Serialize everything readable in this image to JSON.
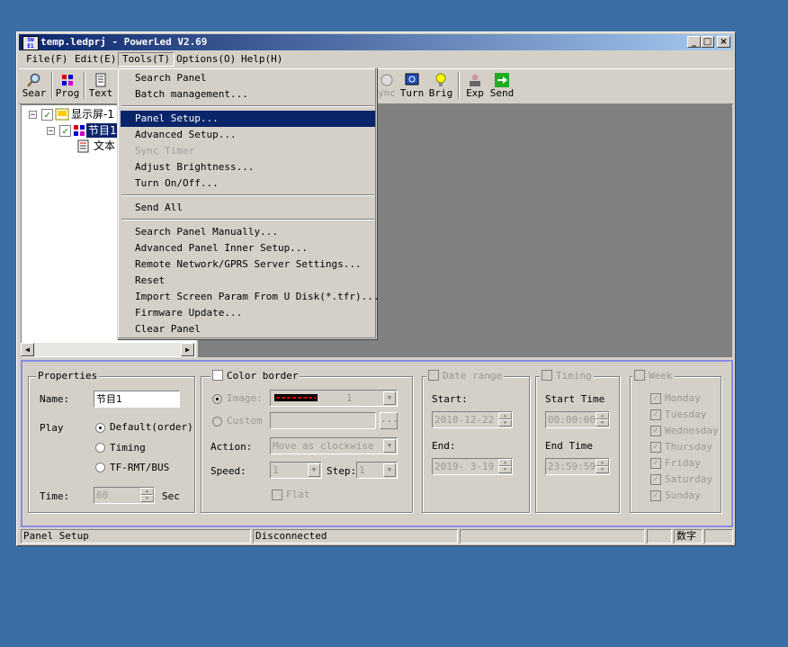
{
  "window": {
    "title": "temp.ledprj - PowerLed V2.69",
    "app_icon_text": "SW E1"
  },
  "title_buttons": {
    "minimize": "_",
    "maximize": "□",
    "close": "×"
  },
  "menubar": [
    "File(F)",
    "Edit(E)",
    "Tools(T)",
    "Options(O)",
    "Help(H)"
  ],
  "toolbar": [
    "Sear",
    "Prog",
    "Text",
    "ync",
    "Turn",
    "Brig",
    "Exp",
    "Send"
  ],
  "tree": {
    "screen": "显示屏-1",
    "program": "节目1",
    "text": "文本"
  },
  "tools_menu": {
    "group1": [
      "Search Panel",
      "Batch management..."
    ],
    "group2": [
      "Panel Setup...",
      "Advanced Setup...",
      "Sync Timer",
      "Adjust Brightness...",
      "Turn On/Off..."
    ],
    "group3": [
      "Send All"
    ],
    "group4": [
      "Search Panel Manually...",
      "Advanced Panel Inner Setup...",
      "Remote Network/GPRS Server Settings...",
      "Reset",
      "Import Screen Param From U Disk(*.tfr)...",
      "Firmware Update...",
      "Clear Panel"
    ]
  },
  "properties": {
    "title": "Properties",
    "name_label": "Name:",
    "name_value": "节目1",
    "play_label": "Play",
    "play_options": [
      "Default(order)",
      "Timing",
      "TF-RMT/BUS"
    ],
    "time_label": "Time:",
    "time_value": "60",
    "time_unit": "Sec"
  },
  "color_border": {
    "title": "Color border",
    "image_label": "Image:",
    "image_value": "1",
    "custom_label": "Custom",
    "browse_label": "...",
    "action_label": "Action:",
    "action_value": "Move as clockwise",
    "speed_label": "Speed:",
    "speed_value": "1",
    "step_label": "Step:",
    "step_value": "1",
    "flat_label": "Flat"
  },
  "date_range": {
    "title": "Date range",
    "start_label": "Start:",
    "start_value": "2010-12-22",
    "end_label": "End:",
    "end_value": "2019- 3-19"
  },
  "timing": {
    "title": "Timing",
    "start_label": "Start Time",
    "start_value": "00:00:00",
    "end_label": "End Time",
    "end_value": "23:59:59"
  },
  "week": {
    "title": "Week",
    "days": [
      "Monday",
      "Tuesday",
      "Wednesday",
      "Thursday",
      "Friday",
      "Saturday",
      "Sunday"
    ]
  },
  "statusbar": {
    "left": "Panel Setup",
    "middle": "Disconnected",
    "ime": "数字"
  }
}
